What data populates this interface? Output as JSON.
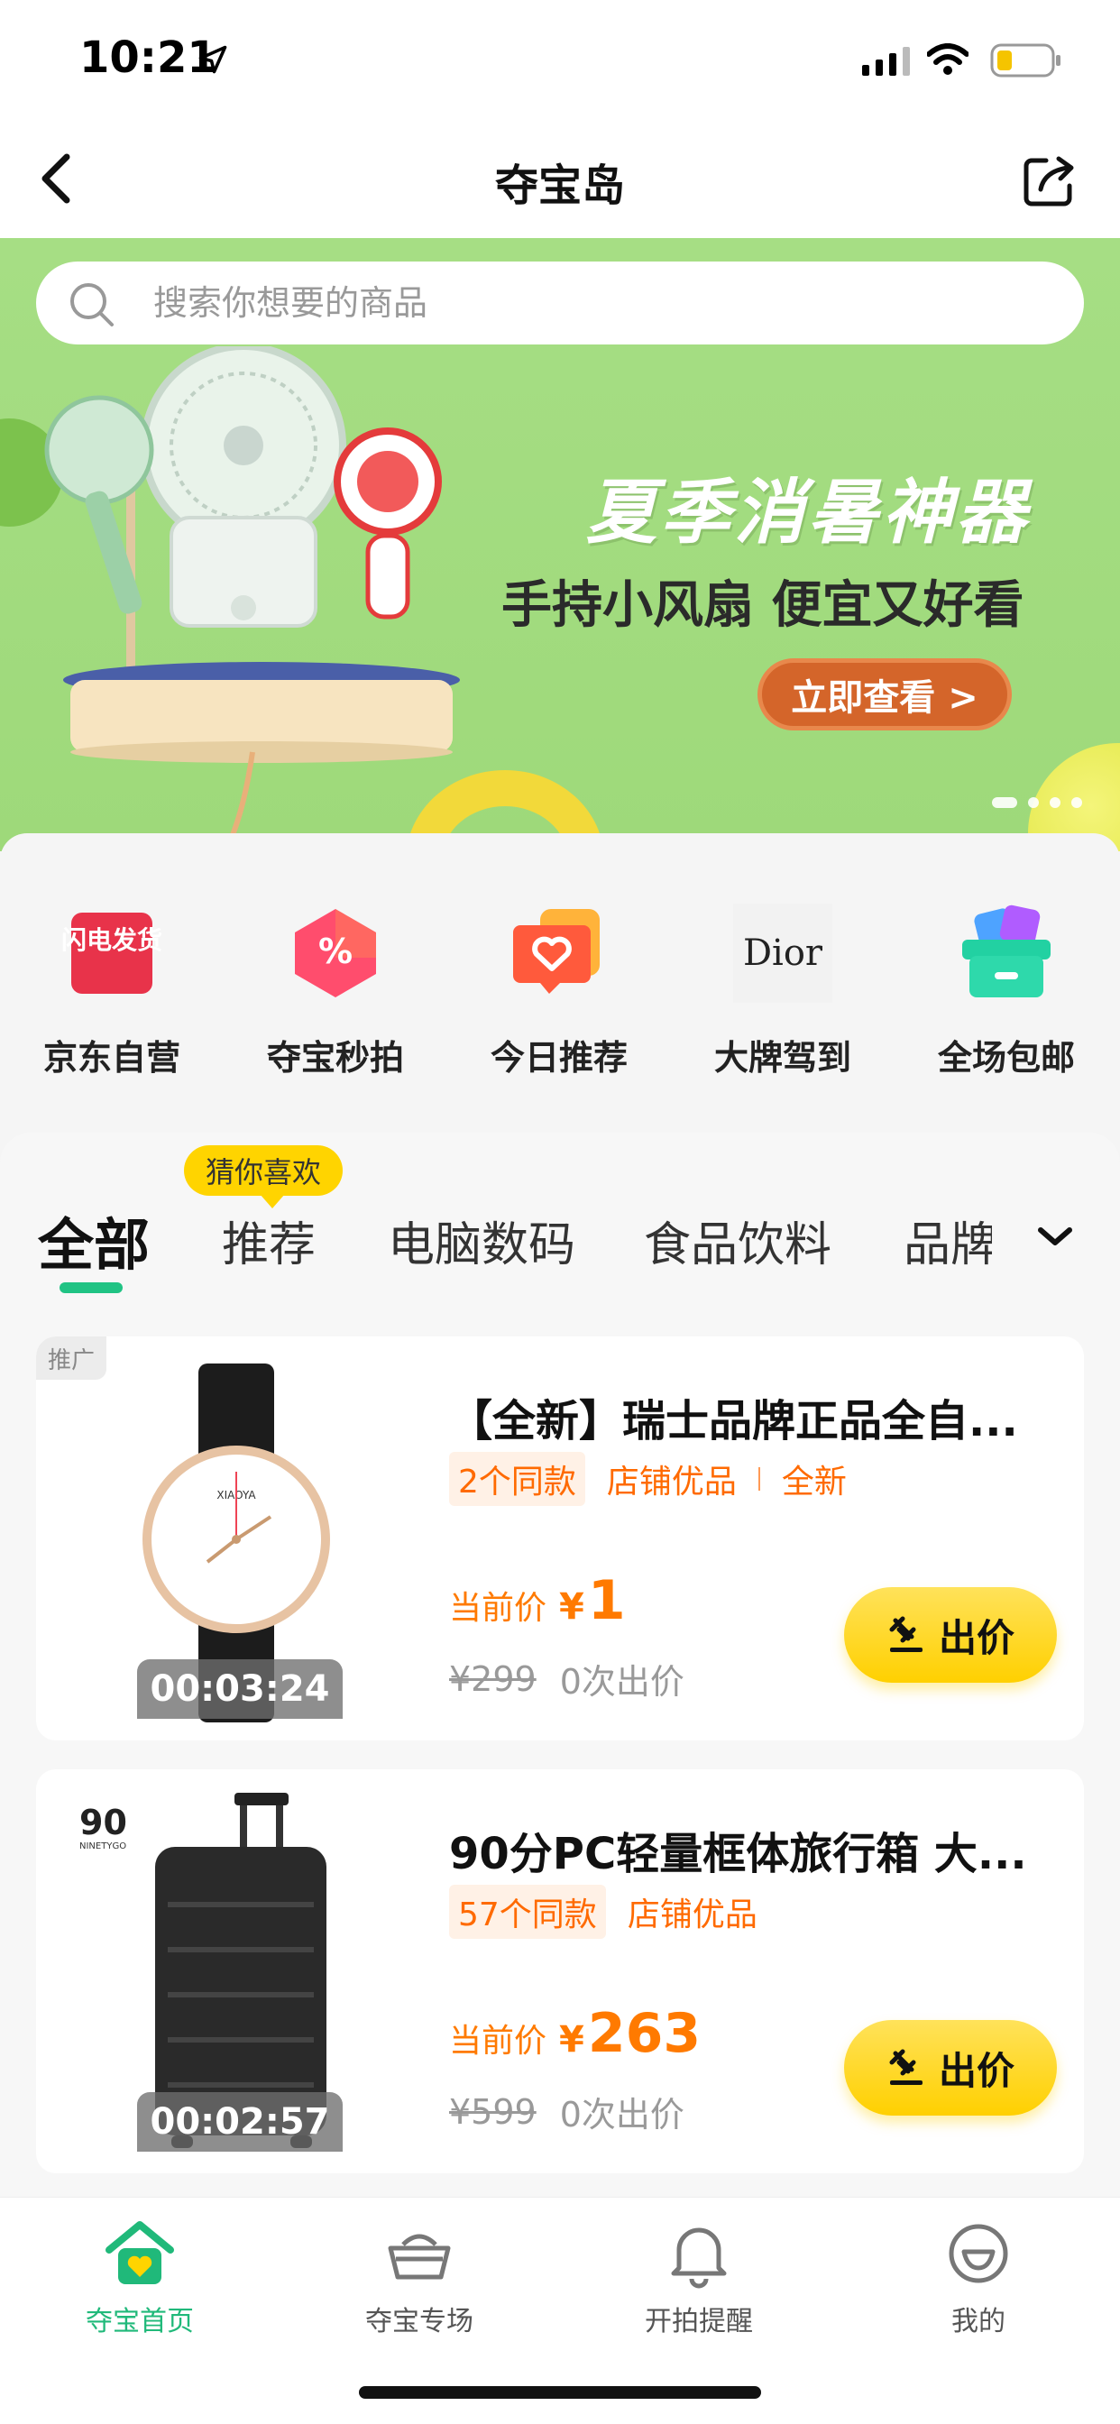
{
  "status": {
    "time": "10:21"
  },
  "nav": {
    "title": "夺宝岛"
  },
  "search": {
    "placeholder": "搜索你想要的商品"
  },
  "banner": {
    "title": "夏季消暑神器",
    "subtitle": "手持小风扇 便宜又好看",
    "button": "立即查看 >",
    "colors": {
      "bg": "#a6de84",
      "button": "#d4652a"
    }
  },
  "quick_menu": [
    {
      "label": "京东自营",
      "icon": "shan-dian-fa-huo-icon",
      "icon_text": "闪电发货"
    },
    {
      "label": "夺宝秒拍",
      "icon": "percent-badge-icon"
    },
    {
      "label": "今日推荐",
      "icon": "heart-card-icon"
    },
    {
      "label": "大牌驾到",
      "icon": "dior-logo-icon",
      "icon_text": "Dior"
    },
    {
      "label": "全场包邮",
      "icon": "gift-box-icon"
    }
  ],
  "tabs": {
    "badge": "猜你喜欢",
    "items": [
      "全部",
      "推荐",
      "电脑数码",
      "食品饮料",
      "品牌"
    ],
    "active_color": "#20c384"
  },
  "products": [
    {
      "ad_tag": "推广",
      "title": "【全新】瑞士品牌正品全自...",
      "tag_box": "2个同款",
      "tags": [
        "店铺优品",
        "全新"
      ],
      "price_label": "当前价",
      "currency": "¥",
      "price": "1",
      "orig_price": "¥299",
      "bids": "0次出价",
      "countdown": "00:03:24",
      "button": "出价",
      "image": "wristwatch-image",
      "brand_text": "XIAOYA"
    },
    {
      "title": "90分PC轻量框体旅行箱 大...",
      "tag_box": "57个同款",
      "tags": [
        "店铺优品"
      ],
      "price_label": "当前价",
      "currency": "¥",
      "price": "263",
      "orig_price": "¥599",
      "bids": "0次出价",
      "countdown": "00:02:57",
      "button": "出价",
      "image": "suitcase-image",
      "brand_text": "90",
      "brand_sub": "NINETYGO"
    }
  ],
  "tabbar": [
    {
      "label": "夺宝首页",
      "icon": "home-icon",
      "active": true
    },
    {
      "label": "夺宝专场",
      "icon": "basket-icon"
    },
    {
      "label": "开拍提醒",
      "icon": "bell-icon"
    },
    {
      "label": "我的",
      "icon": "smile-face-icon"
    }
  ],
  "colors": {
    "price": "#ff7a00",
    "bid_button": "#ffd400",
    "accent": "#20c384"
  }
}
